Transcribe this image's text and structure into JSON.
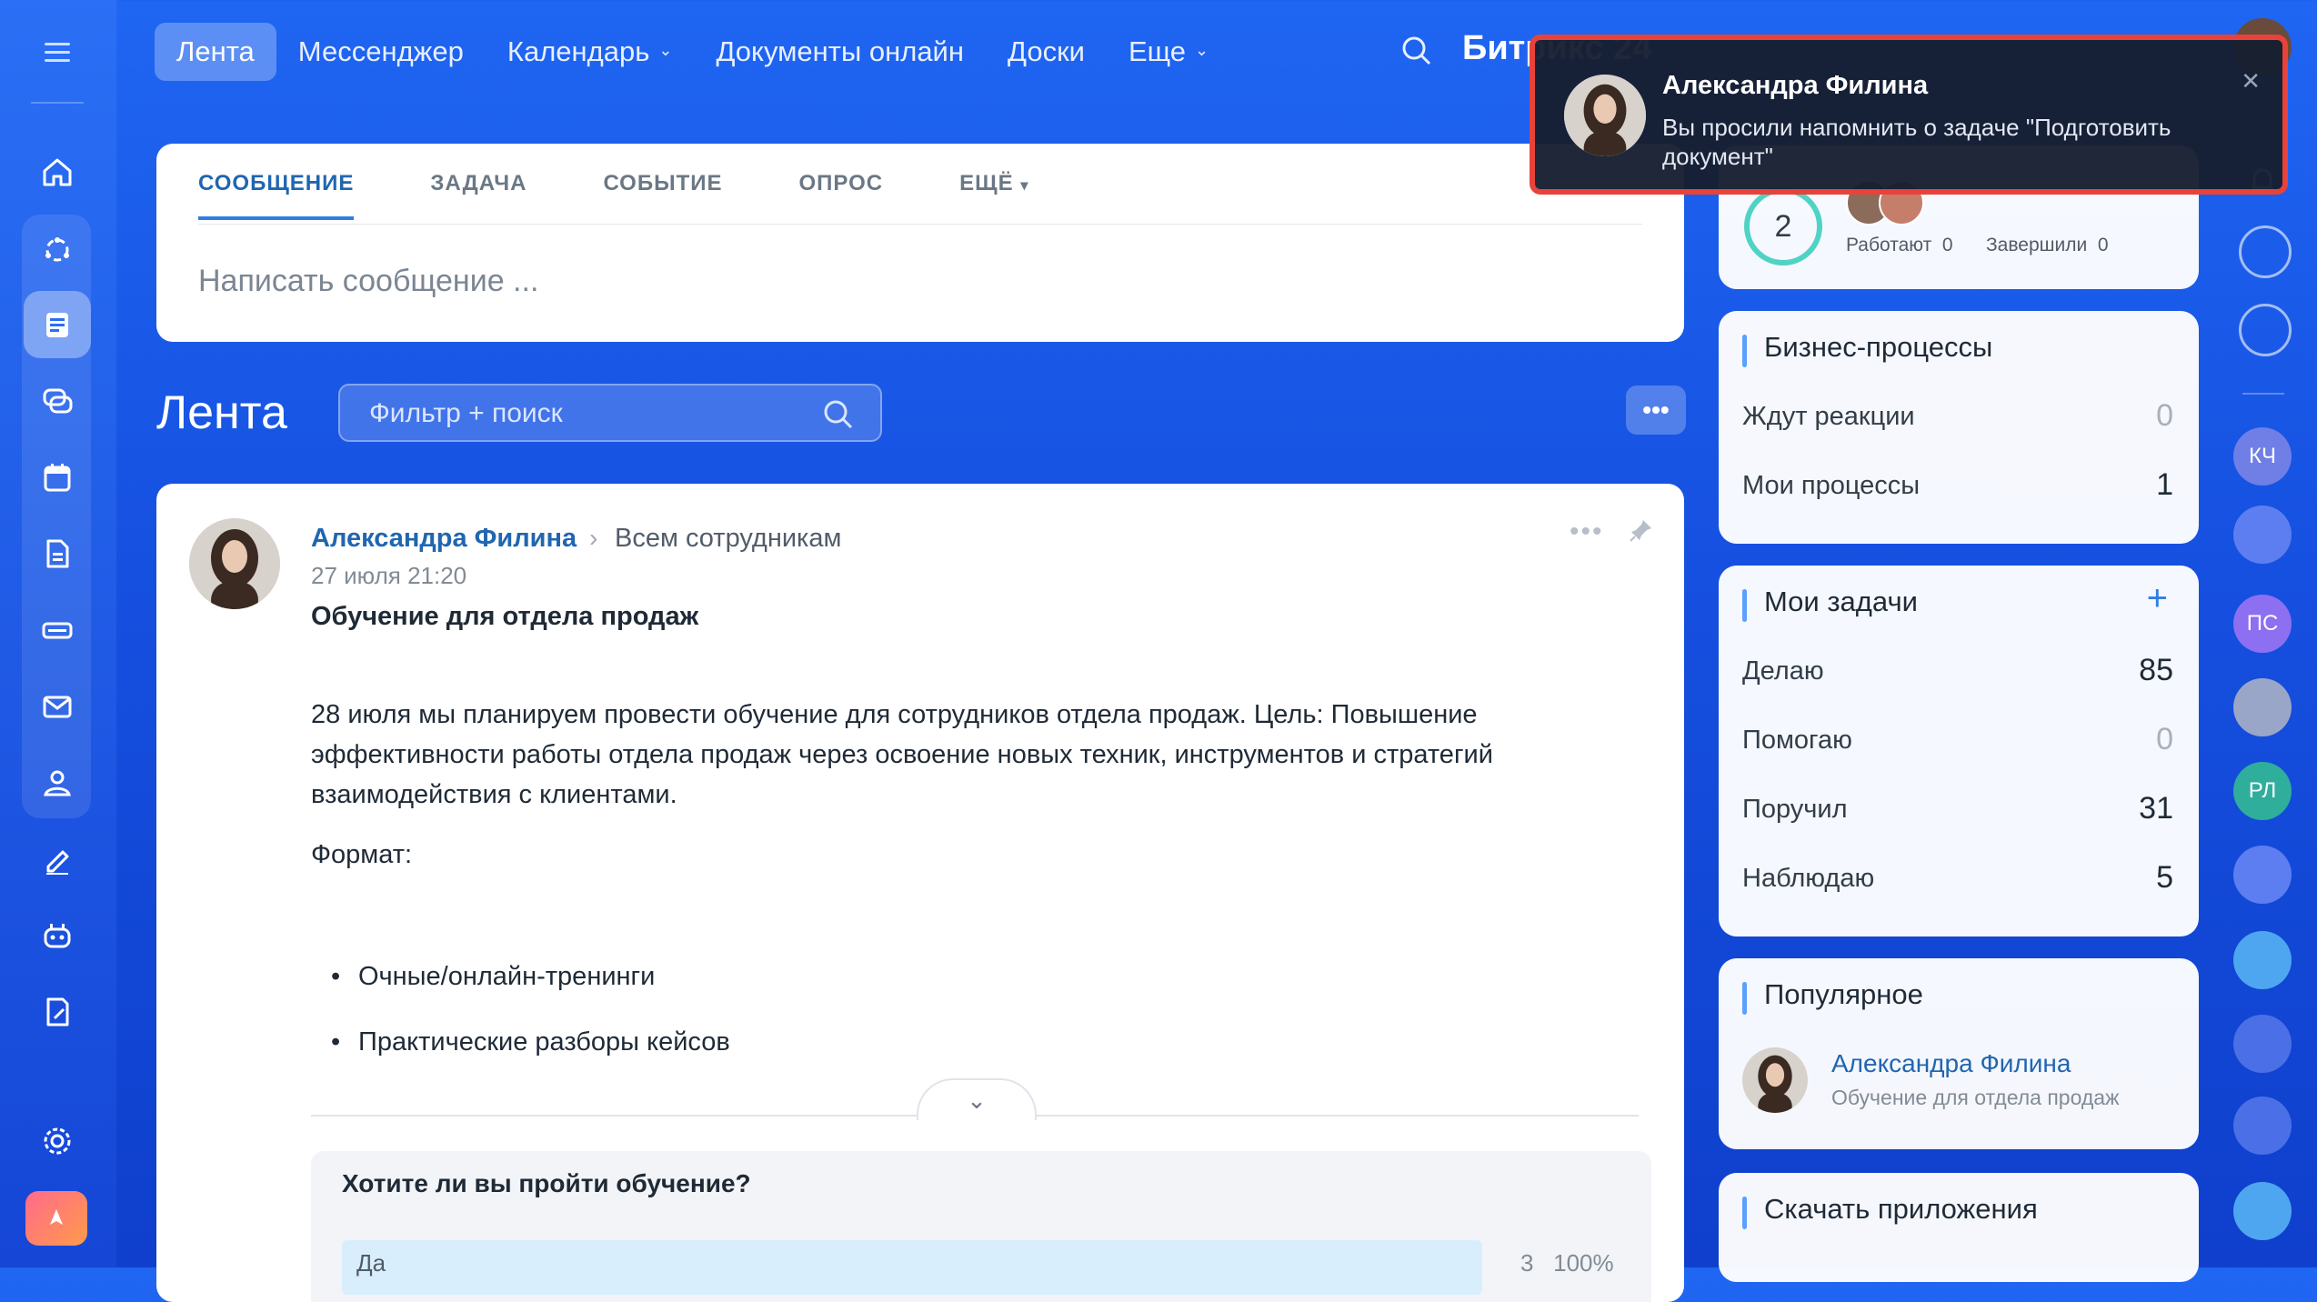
{
  "nav": {
    "items": [
      {
        "label": "Лента",
        "active": true
      },
      {
        "label": "Мессенджер"
      },
      {
        "label": "Календарь",
        "dropdown": true
      },
      {
        "label": "Документы онлайн"
      },
      {
        "label": "Доски"
      },
      {
        "label": "Еще",
        "dropdown": true
      }
    ],
    "brand": "Битрикс 24"
  },
  "composer": {
    "tabs": [
      "СООБЩЕНИЕ",
      "ЗАДАЧА",
      "СОБЫТИЕ",
      "ОПРОС",
      "ЕЩЁ"
    ],
    "placeholder": "Написать сообщение ..."
  },
  "feed": {
    "title": "Лента",
    "filter_placeholder": "Фильтр + поиск"
  },
  "post": {
    "author": "Александра Филина",
    "destination": "Всем сотрудникам",
    "date": "27 июля 21:20",
    "title": "Обучение для отдела продаж",
    "body": "28 июля мы планируем провести обучение для сотрудников отдела продаж. Цель: Повышение эффективности работы отдела продаж через освоение новых техник, инструментов и стратегий взаимодействия с клиентами.",
    "format_label": "Формат:",
    "bullets": [
      "Очные/онлайн-тренинги",
      "Практические разборы кейсов"
    ],
    "poll": {
      "question": "Хотите ли вы пройти обучение?",
      "option": "Да",
      "count": "3",
      "percent": "100%"
    }
  },
  "notification": {
    "title": "Александра Филина",
    "text": "Вы просили напомнить о задаче \"Подготовить документ\""
  },
  "widgets": {
    "efficiency": {
      "value": "2",
      "working_label": "Работают",
      "working_value": "0",
      "done_label": "Завершили",
      "done_value": "0"
    },
    "bp": {
      "title": "Бизнес-процессы",
      "rows": [
        {
          "label": "Ждут реакции",
          "value": "0"
        },
        {
          "label": "Мои процессы",
          "value": "1"
        }
      ]
    },
    "tasks": {
      "title": "Мои задачи",
      "add": "+",
      "rows": [
        {
          "label": "Делаю",
          "value": "85"
        },
        {
          "label": "Помогаю",
          "value": "0"
        },
        {
          "label": "Поручил",
          "value": "31"
        },
        {
          "label": "Наблюдаю",
          "value": "5"
        }
      ]
    },
    "popular": {
      "title": "Популярное",
      "author": "Александра Филина",
      "subtitle": "Обучение для отдела продаж"
    },
    "apps": {
      "title": "Скачать приложения"
    }
  },
  "right_rail": {
    "items": [
      "КЧ",
      "",
      "ПС",
      "",
      "РЛ",
      "",
      "",
      "",
      "",
      ""
    ]
  }
}
